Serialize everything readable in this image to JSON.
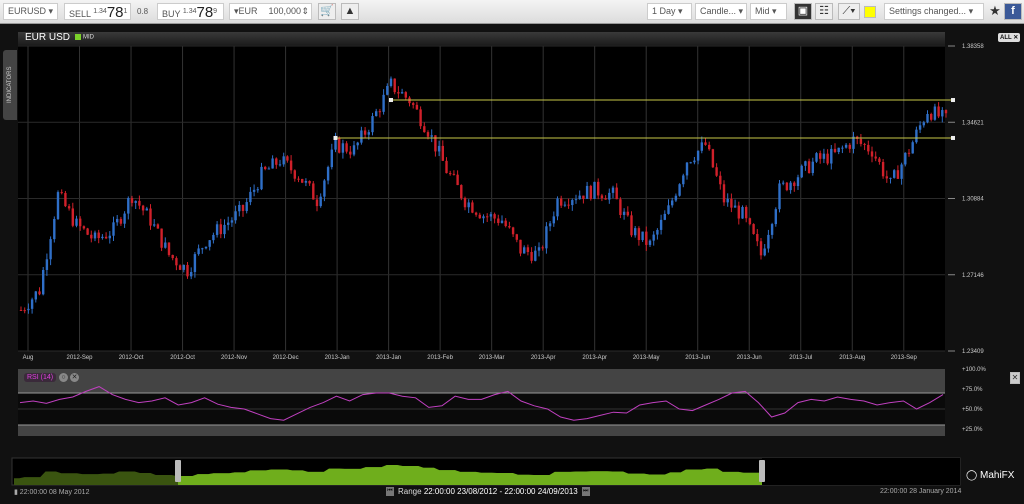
{
  "toolbar": {
    "symbol": "EURUSD",
    "sell_label": "SELL",
    "sell_price_prefix": "1.34",
    "sell_price_big": "78",
    "sell_price_sup": "1",
    "spread": "0.8",
    "buy_label": "BUY",
    "buy_price_prefix": "1.34",
    "buy_price_big": "78",
    "buy_price_sup": "9",
    "currency": "EUR",
    "amount": "100,000",
    "interval": "1 Day",
    "chart_type": "Candle...",
    "price_type": "Mid",
    "settings": "Settings changed..."
  },
  "header": {
    "title": "EUR USD",
    "mid_label": "MID",
    "indicators_tab": "INDICATORS",
    "all_close": "ALL ✕"
  },
  "colors": {
    "up": "#2f6fc8",
    "down": "#d0202a",
    "rsi": "#c040c0",
    "trendline": "#c8c848",
    "nav": "#6fae1c"
  },
  "chart_data": {
    "type": "candlestick",
    "title": "EUR USD",
    "ylim": [
      1.23409,
      1.38358
    ],
    "y_ticks": [
      "1.38358",
      "1.34621",
      "1.30884",
      "1.27146",
      "1.23409"
    ],
    "x_ticks": [
      "Aug",
      "2012-Sep",
      "2012-Oct",
      "2012-Oct",
      "2012-Nov",
      "2012-Dec",
      "2013-Jan",
      "2013-Jan",
      "2013-Feb",
      "2013-Mar",
      "2013-Apr",
      "2013-Apr",
      "2013-May",
      "2013-Jun",
      "2013-Jun",
      "2013-Jul",
      "2013-Aug",
      "2013-Sep"
    ],
    "approx_weekly_close": [
      1.2542,
      1.264,
      1.3106,
      1.2959,
      1.2885,
      1.2934,
      1.3106,
      1.2983,
      1.2812,
      1.2738,
      1.2885,
      1.2959,
      1.3032,
      1.3204,
      1.3277,
      1.3204,
      1.3081,
      1.3351,
      1.3326,
      1.3473,
      1.3645,
      1.3571,
      1.3424,
      1.3228,
      1.3081,
      1.3008,
      1.2983,
      1.2836,
      1.2812,
      1.3081,
      1.3106,
      1.313,
      1.3106,
      1.2934,
      1.2861,
      1.3032,
      1.3277,
      1.3351,
      1.3081,
      1.3008,
      1.2812,
      1.313,
      1.3204,
      1.3277,
      1.3302,
      1.3375,
      1.3326,
      1.3155,
      1.3326,
      1.3522,
      1.3473
    ],
    "trendlines": [
      {
        "from_index": 20,
        "level": 1.3571
      },
      {
        "from_index": 17,
        "level": 1.3385
      }
    ],
    "rsi": {
      "label": "RSI (14)",
      "ylim": [
        0,
        100
      ],
      "y_ticks": [
        "+100.0%",
        "+75.0%",
        "+50.0%",
        "+25.0%"
      ],
      "bands": [
        70,
        30
      ],
      "values": [
        58,
        60,
        57,
        62,
        65,
        72,
        78,
        68,
        62,
        58,
        60,
        64,
        55,
        58,
        64,
        56,
        52,
        50,
        44,
        38,
        36,
        44,
        52,
        58,
        66,
        60,
        68,
        70,
        70,
        66,
        64,
        52,
        54,
        66,
        62,
        62,
        68,
        72,
        60,
        54,
        50,
        40,
        36,
        38,
        42,
        46,
        45,
        55,
        58,
        60,
        50,
        48,
        55,
        62,
        70,
        72,
        58,
        40,
        45,
        58,
        62,
        60,
        65,
        62,
        60,
        55,
        58,
        60,
        50,
        58,
        68
      ]
    }
  },
  "navigator": {
    "start": "22:00:00 08 May 2012",
    "end": "22:00:00 28 January 2014",
    "range_label": "Range",
    "range_value": "22:00:00 23/08/2012 - 22:00:00 24/09/2013",
    "brand": "MahiFX"
  }
}
